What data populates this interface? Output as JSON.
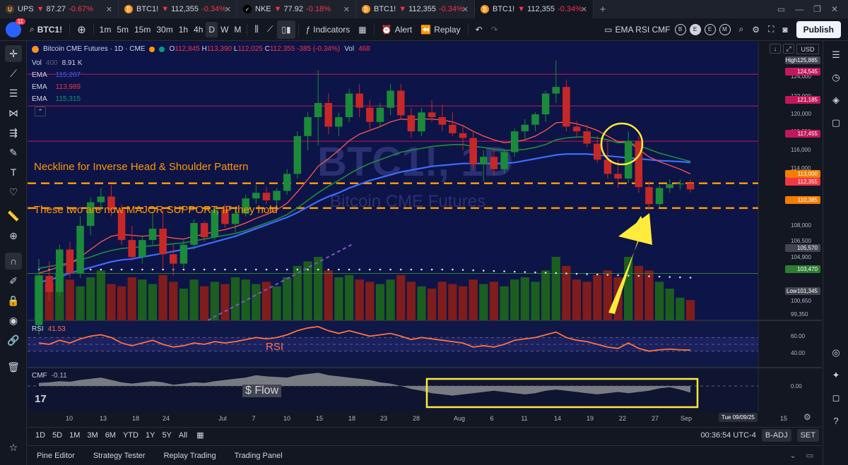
{
  "browser_tabs": [
    {
      "symbol": "UPS",
      "price": "87.27",
      "change": "-0.67%",
      "fav_color": "#5b3a1a",
      "fav_text": "U"
    },
    {
      "symbol": "BTC1!",
      "price": "112,355",
      "change": "-0.34%",
      "fav_color": "#f7931a",
      "fav_text": "₿"
    },
    {
      "symbol": "NKE",
      "price": "77.92",
      "change": "-0.18%",
      "fav_color": "#000000",
      "fav_text": "✓"
    },
    {
      "symbol": "BTC1!",
      "price": "112,355",
      "change": "-0.34%",
      "fav_color": "#f7931a",
      "fav_text": "₿"
    },
    {
      "symbol": "BTC1!",
      "price": "112,355",
      "change": "-0.34%",
      "fav_color": "#f7931a",
      "fav_text": "₿"
    }
  ],
  "toolbar": {
    "notification_count": "11",
    "symbol": "BTC1!",
    "timeframes": [
      "1m",
      "5m",
      "15m",
      "30m",
      "1h",
      "4h",
      "D",
      "W",
      "M"
    ],
    "selected_timeframe": "D",
    "indicators_label": "Indicators",
    "alert_label": "Alert",
    "replay_label": "Replay",
    "layout_name": "EMA RSI CMF",
    "layout_badges": [
      "B",
      "E",
      "E",
      "M"
    ],
    "publish_label": "Publish"
  },
  "chart": {
    "title": "Bitcoin CME Futures · 1D · CME",
    "ohlc": {
      "o_label": "O",
      "o": "112,845",
      "h_label": "H",
      "h": "113,390",
      "l_label": "L",
      "l": "112,025",
      "c_label": "C",
      "c": "112,355",
      "chg": "-385 (-0.34%)"
    },
    "vol_label": "Vol",
    "vol_value": "468",
    "watermark_symbol": "BTC1!, 1D",
    "watermark_name": "Bitcoin CME Futures",
    "currency": "USD",
    "indicators": [
      {
        "name": "Vol",
        "param": "400",
        "value": "8.91 K",
        "color": "#d1d4dc"
      },
      {
        "name": "EMA",
        "param": "",
        "value": "115,207",
        "color": "#2962ff"
      },
      {
        "name": "EMA",
        "param": "",
        "value": "113,989",
        "color": "#f23645"
      },
      {
        "name": "EMA",
        "param": "",
        "value": "115,315",
        "color": "#089981"
      }
    ],
    "annotations": {
      "neckline": "Neckline for Inverse Head & Shoulder Pattern",
      "support": "These two  are now MAJOR SUPPORT, IF they hold",
      "rsi_note": "RSI",
      "flow_note": "$ Flow"
    },
    "price_labels": [
      {
        "text": "High",
        "value": "125,885",
        "color": "#434651"
      },
      {
        "text": "",
        "value": "124,545",
        "color": "#c2185b"
      },
      {
        "text": "",
        "value": "121,185",
        "color": "#c2185b"
      },
      {
        "text": "",
        "value": "117,455",
        "color": "#c2185b"
      },
      {
        "text": "",
        "value": "113,000",
        "color": "#f57c00"
      },
      {
        "text": "",
        "value": "112,355",
        "color": "#f23645"
      },
      {
        "text": "",
        "value": "110,385",
        "color": "#f57c00"
      },
      {
        "text": "",
        "value": "105,570",
        "color": "#434651"
      },
      {
        "text": "",
        "value": "103,470",
        "color": "#2e7d32"
      },
      {
        "text": "Low",
        "value": "101,345",
        "color": "#434651"
      }
    ],
    "price_scale": [
      "124,000",
      "122,000",
      "120,000",
      "118,000",
      "116,000",
      "114,000",
      "108,000",
      "106,500",
      "104,900",
      "100,650",
      "99,350"
    ],
    "x_labels": [
      "10",
      "13",
      "18",
      "24",
      "Jul",
      "7",
      "10",
      "15",
      "18",
      "23",
      "28",
      "Aug",
      "6",
      "11",
      "14",
      "19",
      "22",
      "27",
      "Sep",
      "5",
      "15"
    ],
    "crosshair_date": "Tue 09/09/25",
    "rsi": {
      "name": "RSI",
      "value": "41.53",
      "levels": [
        "60.00",
        "40.00"
      ]
    },
    "cmf": {
      "name": "CMF",
      "value": "-0.11",
      "level": "0.00"
    }
  },
  "range_bar": {
    "ranges": [
      "1D",
      "5D",
      "1M",
      "3M",
      "6M",
      "YTD",
      "1Y",
      "5Y",
      "All"
    ],
    "clock": "00:36:54 UTC-4",
    "badj": "B-ADJ",
    "set": "SET"
  },
  "bottom_panel": {
    "tabs": [
      "Pine Editor",
      "Strategy Tester",
      "Replay Trading",
      "Trading Panel"
    ]
  },
  "chart_data": {
    "type": "candlestick",
    "ohlc_series": [
      [
        98000,
        105000,
        97000,
        103200
      ],
      [
        103200,
        104800,
        100500,
        101500
      ],
      [
        101500,
        106500,
        101000,
        106000
      ],
      [
        106000,
        106800,
        103000,
        103500
      ],
      [
        103500,
        109500,
        103000,
        108500
      ],
      [
        108500,
        111500,
        107500,
        111000
      ],
      [
        111000,
        112500,
        110000,
        111600
      ],
      [
        111600,
        112800,
        109500,
        110200
      ],
      [
        110200,
        110800,
        106500,
        107000
      ],
      [
        107000,
        108500,
        104800,
        105200
      ],
      [
        105200,
        107500,
        104500,
        107000
      ],
      [
        107000,
        110000,
        106500,
        108200
      ],
      [
        108200,
        110200,
        104000,
        105500
      ],
      [
        105500,
        106500,
        103200,
        104500
      ],
      [
        104500,
        107000,
        104000,
        106500
      ],
      [
        106500,
        109200,
        106000,
        108800
      ],
      [
        108800,
        109000,
        106800,
        107300
      ],
      [
        107300,
        110500,
        107000,
        110200
      ],
      [
        110200,
        110800,
        108300,
        108700
      ],
      [
        108700,
        110500,
        107800,
        109800
      ],
      [
        109800,
        111800,
        109500,
        111400
      ],
      [
        111400,
        112800,
        110800,
        112000
      ],
      [
        112000,
        112600,
        110800,
        111200
      ],
      [
        111200,
        112500,
        110500,
        112200
      ],
      [
        112200,
        114500,
        111800,
        114000
      ],
      [
        114000,
        118500,
        113500,
        118000
      ],
      [
        118000,
        120500,
        116500,
        120000
      ],
      [
        120000,
        125000,
        117000,
        121500
      ],
      [
        121500,
        122500,
        118200,
        119000
      ],
      [
        119000,
        120500,
        118000,
        120000
      ],
      [
        120000,
        123000,
        119500,
        122500
      ],
      [
        122500,
        123500,
        120000,
        121000
      ],
      [
        121000,
        121800,
        118500,
        119500
      ],
      [
        119500,
        121500,
        119000,
        121000
      ],
      [
        121000,
        123500,
        120200,
        122800
      ],
      [
        122800,
        123500,
        119800,
        120200
      ],
      [
        120200,
        121000,
        117800,
        118500
      ],
      [
        118500,
        121000,
        118000,
        120500
      ],
      [
        120500,
        121800,
        119500,
        120000
      ],
      [
        120000,
        121300,
        118500,
        119200
      ],
      [
        119200,
        120500,
        118000,
        118300
      ],
      [
        118300,
        119000,
        116500,
        117800
      ],
      [
        117800,
        118500,
        114500,
        115000
      ],
      [
        115000,
        116500,
        113200,
        115800
      ],
      [
        115800,
        116800,
        113800,
        114500
      ],
      [
        114500,
        116500,
        114000,
        116300
      ],
      [
        116300,
        118800,
        115800,
        118500
      ],
      [
        118500,
        119800,
        117500,
        119200
      ],
      [
        119200,
        120500,
        118500,
        120300
      ],
      [
        120300,
        122800,
        119500,
        122500
      ],
      [
        122500,
        126000,
        121500,
        123200
      ],
      [
        123200,
        124000,
        118500,
        119000
      ],
      [
        119000,
        119600,
        117800,
        118500
      ],
      [
        118500,
        119200,
        116800,
        117200
      ],
      [
        117200,
        118000,
        115200,
        115500
      ],
      [
        115500,
        117500,
        113500,
        114000
      ],
      [
        114000,
        115500,
        112500,
        113500
      ],
      [
        113500,
        118500,
        113000,
        117500
      ],
      [
        117500,
        118000,
        112000,
        112600
      ],
      [
        112600,
        113200,
        110200,
        110800
      ],
      [
        110800,
        112800,
        110500,
        112500
      ],
      [
        112500,
        113400,
        112000,
        112900
      ],
      [
        112900,
        113400,
        112300,
        113000
      ],
      [
        113000,
        113400,
        112025,
        112355
      ]
    ],
    "volume": [
      40,
      34,
      42,
      36,
      30,
      38,
      44,
      32,
      30,
      38,
      36,
      32,
      40,
      34,
      28,
      36,
      30,
      34,
      32,
      38,
      36,
      32,
      34,
      30,
      38,
      48,
      52,
      56,
      44,
      38,
      40,
      36,
      34,
      32,
      36,
      40,
      34,
      30,
      28,
      34,
      32,
      30,
      36,
      32,
      34,
      30,
      36,
      38,
      34,
      44,
      56,
      48,
      36,
      34,
      40,
      44,
      38,
      56,
      48,
      44,
      34,
      28,
      20,
      18
    ],
    "ema_blue": [
      102500,
      102800,
      103100,
      103500,
      103800,
      104100,
      104400,
      104700,
      104900,
      105000,
      105200,
      105400,
      105600,
      105800,
      106000,
      106200,
      106500,
      106800,
      107100,
      107400,
      107800,
      108200,
      108600,
      109000,
      109400,
      109900,
      110500,
      111100,
      111600,
      112000,
      112500,
      112900,
      113300,
      113600,
      113900,
      114200,
      114400,
      114600,
      114800,
      114900,
      115000,
      115100,
      115100,
      115100,
      115100,
      115100,
      115200,
      115400,
      115600,
      115800,
      116000,
      116100,
      116100,
      116100,
      116000,
      115900,
      115800,
      115700,
      115600,
      115500,
      115400,
      115350,
      115300,
      115207
    ],
    "ema_red": [
      103500,
      103800,
      104200,
      104500,
      105200,
      106000,
      106800,
      107400,
      107600,
      107500,
      107400,
      107500,
      107400,
      107200,
      107100,
      107400,
      107600,
      107900,
      108100,
      108400,
      108800,
      109300,
      109700,
      110200,
      110900,
      112100,
      113400,
      114800,
      115600,
      116500,
      117500,
      118200,
      118600,
      119000,
      119500,
      119800,
      119700,
      119800,
      119800,
      119700,
      119500,
      119100,
      118500,
      118000,
      117600,
      117300,
      117400,
      117600,
      118000,
      118600,
      119400,
      119500,
      119300,
      119000,
      118600,
      118000,
      117400,
      117400,
      116600,
      115800,
      115300,
      114900,
      114500,
      113989
    ],
    "ema_green": [
      104000,
      104200,
      104400,
      104600,
      104900,
      105200,
      105600,
      105900,
      106100,
      106200,
      106300,
      106400,
      106500,
      106600,
      106700,
      106900,
      107100,
      107300,
      107500,
      107700,
      108000,
      108400,
      108800,
      109200,
      109700,
      110400,
      111200,
      112000,
      112700,
      113300,
      114000,
      114600,
      115100,
      115500,
      115900,
      116300,
      116500,
      116700,
      116900,
      117000,
      117100,
      117100,
      116900,
      116800,
      116600,
      116500,
      116500,
      116600,
      116800,
      117100,
      117600,
      117800,
      117900,
      117900,
      117800,
      117600,
      117300,
      117300,
      117000,
      116600,
      116200,
      115900,
      115600,
      115315
    ],
    "rsi_values": [
      52,
      50,
      56,
      52,
      58,
      62,
      64,
      60,
      52,
      48,
      52,
      56,
      50,
      46,
      48,
      52,
      50,
      54,
      52,
      54,
      57,
      60,
      58,
      60,
      64,
      70,
      74,
      76,
      70,
      66,
      70,
      66,
      62,
      64,
      66,
      62,
      57,
      60,
      58,
      56,
      54,
      52,
      46,
      48,
      46,
      50,
      56,
      58,
      60,
      64,
      68,
      60,
      56,
      54,
      50,
      46,
      44,
      52,
      44,
      40,
      42,
      43,
      42,
      41.53
    ],
    "cmf_values": [
      0.05,
      0.06,
      0.08,
      0.07,
      0.1,
      0.12,
      0.14,
      0.1,
      0.06,
      0.04,
      0.06,
      0.08,
      0.06,
      0.02,
      0.04,
      0.06,
      0.05,
      0.08,
      0.1,
      0.12,
      0.14,
      0.18,
      0.16,
      0.15,
      0.14,
      0.18,
      0.2,
      0.22,
      0.18,
      0.16,
      0.14,
      0.12,
      0.1,
      0.06,
      0.04,
      0.0,
      -0.05,
      -0.08,
      -0.12,
      -0.14,
      -0.16,
      -0.14,
      -0.12,
      -0.1,
      -0.08,
      -0.1,
      -0.12,
      -0.14,
      -0.12,
      -0.08,
      -0.06,
      -0.08,
      -0.1,
      -0.12,
      -0.14,
      -0.12,
      -0.1,
      -0.12,
      -0.1,
      -0.08,
      -0.04,
      -0.02,
      -0.06,
      -0.11
    ],
    "horizontal_levels": [
      124545,
      121185,
      117455,
      113000,
      110385,
      103470
    ],
    "ylim": [
      98500,
      126500
    ]
  }
}
